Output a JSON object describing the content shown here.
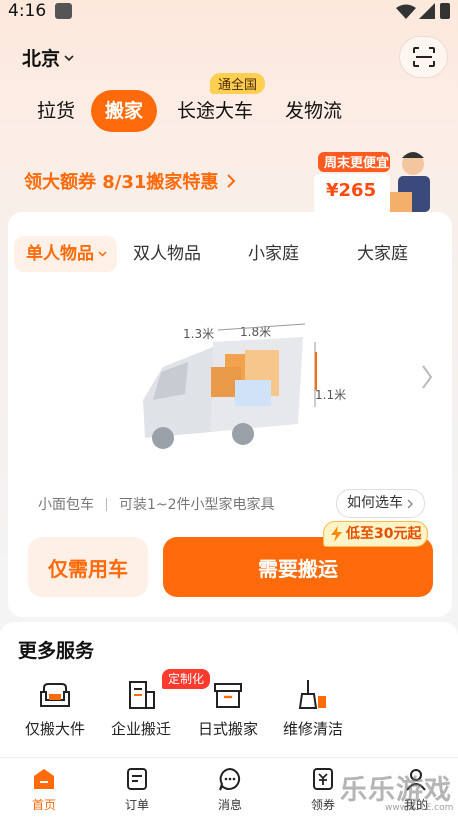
{
  "status_bar": {
    "time": "4:16"
  },
  "header": {
    "city": "北京"
  },
  "service_tabs": [
    {
      "label": "拉货"
    },
    {
      "label": "搬家"
    },
    {
      "label": "长途大车",
      "badge": "通全国"
    },
    {
      "label": "发物流"
    }
  ],
  "promo": {
    "text": "领大额券 8/31搬家特惠",
    "art_title": "周末更便宜",
    "art_price": "¥265"
  },
  "move_categories": [
    "单人物品",
    "双人物品",
    "小家庭",
    "大家庭"
  ],
  "vehicle": {
    "dimensions": {
      "width": "1.3米",
      "length": "1.8米",
      "height": "1.1米"
    },
    "name": "小面包车",
    "capacity": "可装1~2件小型家电家具",
    "how_to": "如何选车"
  },
  "actions": {
    "car_only": "仅需用车",
    "need_moving": "需要搬运",
    "price_badge": "低至30元起"
  },
  "more_services": {
    "title": "更多服务",
    "items": [
      {
        "label": "仅搬大件",
        "icon": "sofa-icon"
      },
      {
        "label": "企业搬迁",
        "icon": "building-icon",
        "badge": "定制化"
      },
      {
        "label": "日式搬家",
        "icon": "box-icon"
      },
      {
        "label": "维修清洁",
        "icon": "cleaning-icon"
      }
    ]
  },
  "bottom_nav": [
    {
      "label": "首页",
      "icon": "home-icon"
    },
    {
      "label": "订单",
      "icon": "order-icon"
    },
    {
      "label": "消息",
      "icon": "message-icon"
    },
    {
      "label": "领券",
      "icon": "coupon-icon"
    },
    {
      "label": "我的",
      "icon": "profile-icon"
    }
  ],
  "watermark": {
    "text": "乐乐游戏",
    "url": "www.61LE.com"
  },
  "colors": {
    "accent": "#ff6a0a",
    "badge_yellow": "#ffcf52",
    "badge_red": "#ff3b30"
  }
}
